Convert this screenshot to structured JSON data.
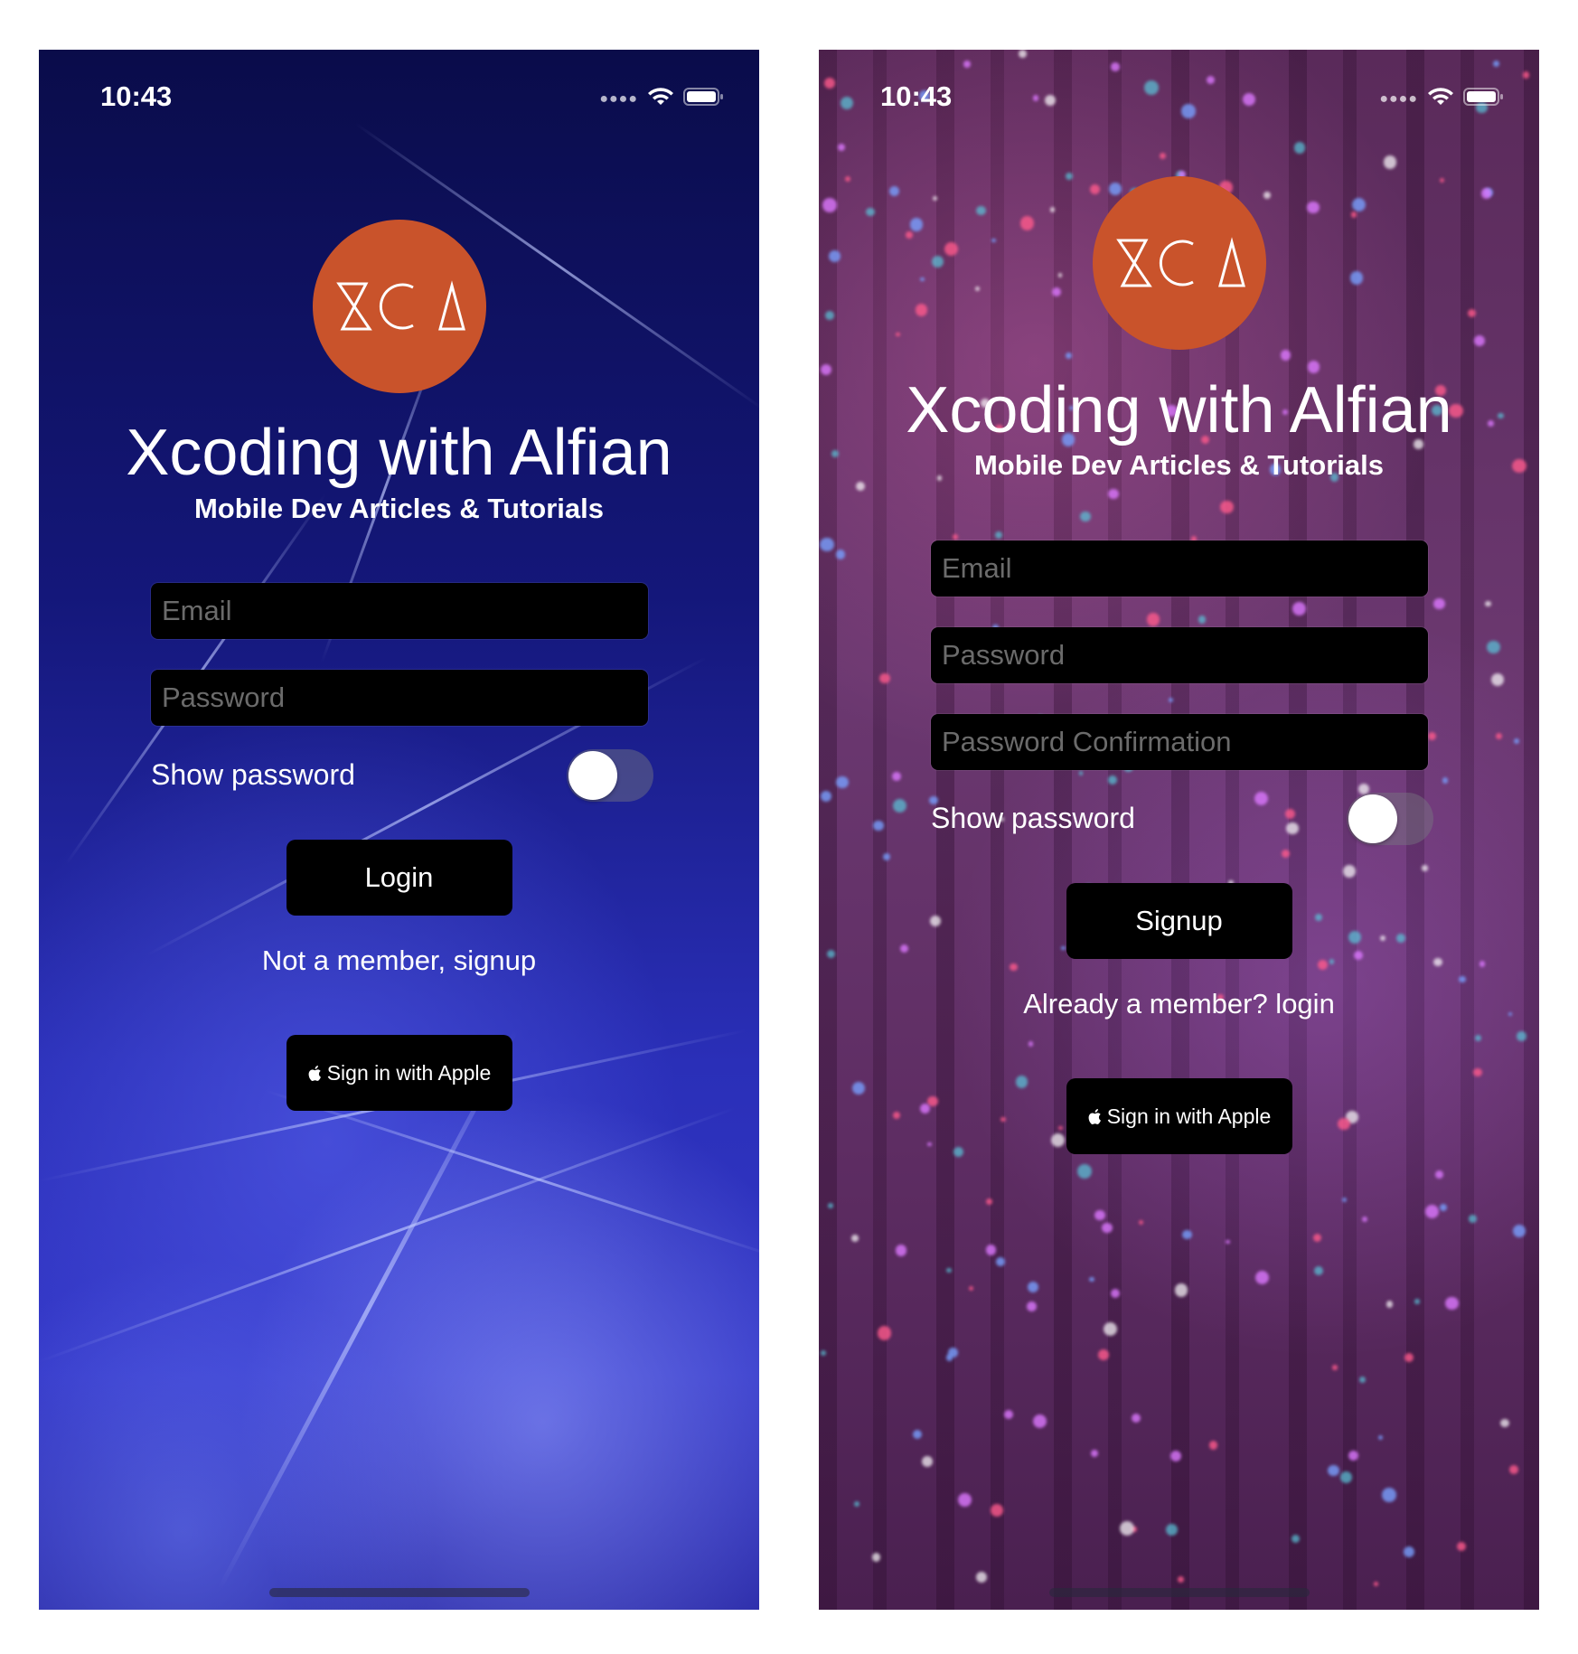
{
  "screens": {
    "login": {
      "status_time": "10:43",
      "logo_text": "XCA",
      "title": "Xcoding with Alfian",
      "subtitle": "Mobile Dev Articles & Tutorials",
      "email_placeholder": "Email",
      "password_placeholder": "Password",
      "show_password_label": "Show password",
      "show_password_on": false,
      "primary_button": "Login",
      "switch_link": "Not a member, signup",
      "apple_button": "Sign in with Apple"
    },
    "signup": {
      "status_time": "10:43",
      "logo_text": "XCA",
      "title": "Xcoding with Alfian",
      "subtitle": "Mobile Dev Articles & Tutorials",
      "email_placeholder": "Email",
      "password_placeholder": "Password",
      "password_confirmation_placeholder": "Password Confirmation",
      "show_password_label": "Show password",
      "show_password_on": false,
      "primary_button": "Signup",
      "switch_link": "Already a member? login",
      "apple_button": "Sign in with Apple"
    }
  },
  "colors": {
    "logo_background": "#c9532b",
    "field_background": "#000000",
    "button_background": "#000000",
    "text": "#ffffff",
    "placeholder": "#6b6b6b"
  },
  "icons": [
    "signal-dots-icon",
    "wifi-icon",
    "battery-icon",
    "apple-icon",
    "xca-logo"
  ]
}
